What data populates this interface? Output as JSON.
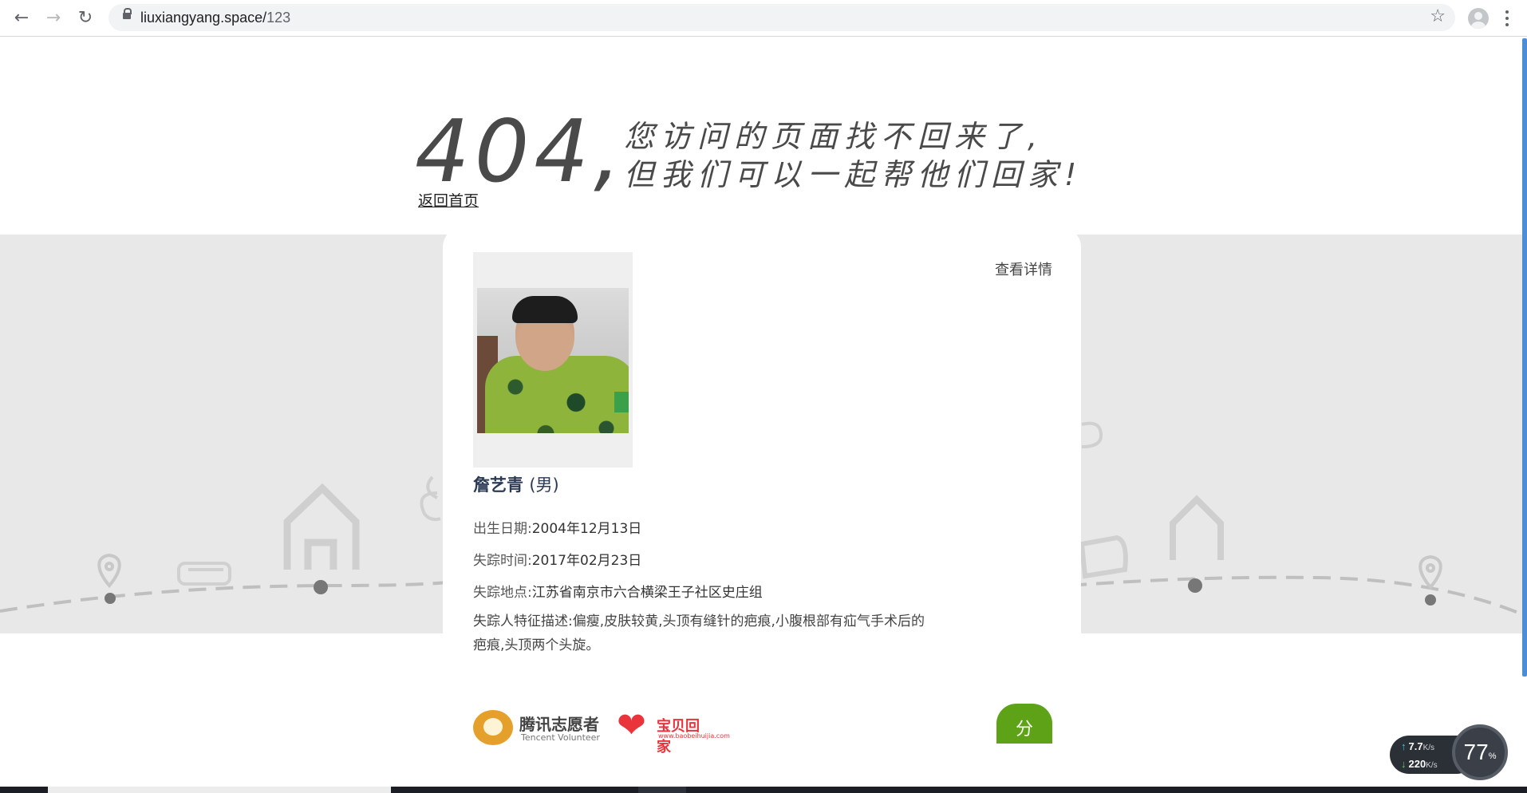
{
  "browser": {
    "url_host": "liuxiangyang.space/",
    "url_path": "123"
  },
  "hero": {
    "code": "404,",
    "line1": "您访问的页面找不回来了,",
    "line2": "但我们可以一起帮他们回家!"
  },
  "home_link": "返回首页",
  "card": {
    "detail_link": "查看详情",
    "name": "詹艺青",
    "gender": "(男)",
    "birth_label": "出生日期:",
    "birth_value": "2004年12月13日",
    "missing_time_label": "失踪时间:",
    "missing_time_value": "2017年02月23日",
    "missing_place_label": "失踪地点:",
    "missing_place_value": "江苏省南京市六合横梁王子社区史庄组",
    "description": "失踪人特征描述:偏瘦,皮肤较黄,头顶有缝针的疤痕,小腹根部有疝气手术后的疤痕,头顶两个头旋。",
    "share_label": "分"
  },
  "logos": {
    "tencent_cn": "腾讯志愿者",
    "tencent_en": "Tencent Volunteer",
    "baobei_cn": "宝贝回家",
    "baobei_url": "www.baobeihuijia.com"
  },
  "net_monitor": {
    "upload": "7.7",
    "download": "220",
    "unit": "K/s",
    "percent": "77",
    "percent_sign": "%"
  },
  "colors": {
    "band": "#e8e8e8",
    "share_button": "#5ea317",
    "name": "#2b3a55",
    "scrollbar": "#4a8ed6"
  }
}
